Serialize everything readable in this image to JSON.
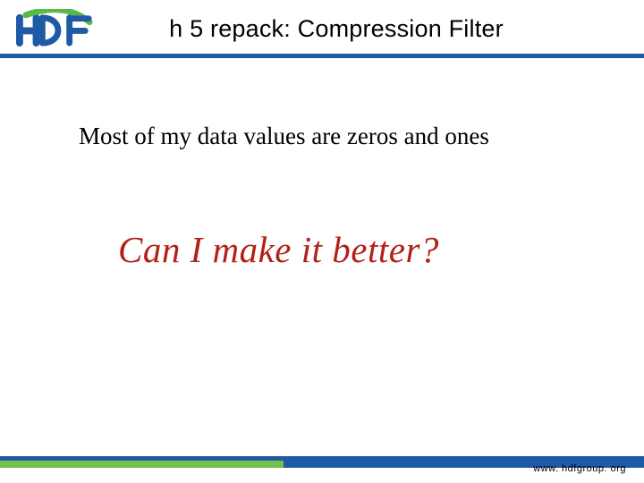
{
  "header": {
    "logo_text_main": "HDF",
    "title": "h 5 repack: Compression Filter"
  },
  "body": {
    "line1": "Most of my data values are zeros and ones",
    "callout": "Can I make it better?"
  },
  "footer": {
    "url": "www. hdfgroup. org"
  },
  "colors": {
    "accent_blue": "#1f5aa6",
    "accent_green": "#73c04a",
    "callout_red": "#b22018"
  }
}
